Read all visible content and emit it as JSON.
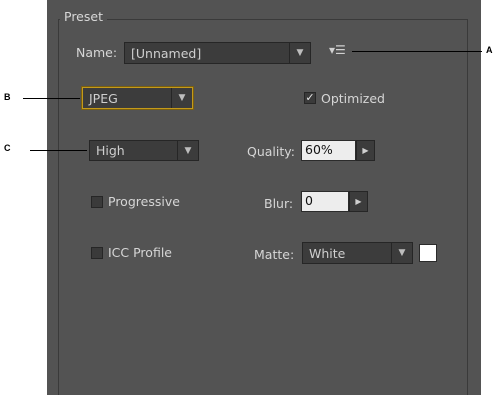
{
  "preset": {
    "title": "Preset",
    "name_label": "Name:",
    "name_value": "[Unnamed]",
    "menu_icon_glyph": "▾☰"
  },
  "format": {
    "value": "JPEG"
  },
  "optimized": {
    "label": "Optimized",
    "checked": true,
    "check_glyph": "✓"
  },
  "quality_preset": {
    "value": "High"
  },
  "quality": {
    "label": "Quality:",
    "value": "60%"
  },
  "progressive": {
    "label": "Progressive",
    "checked": false
  },
  "blur": {
    "label": "Blur:",
    "value": "0"
  },
  "icc_profile": {
    "label": "ICC Profile",
    "checked": false
  },
  "matte": {
    "label": "Matte:",
    "value": "White",
    "swatch_color": "#ffffff"
  },
  "arrows": {
    "down": "▼",
    "right": "▶"
  },
  "callouts": {
    "a": "A",
    "b": "B",
    "c": "C"
  }
}
